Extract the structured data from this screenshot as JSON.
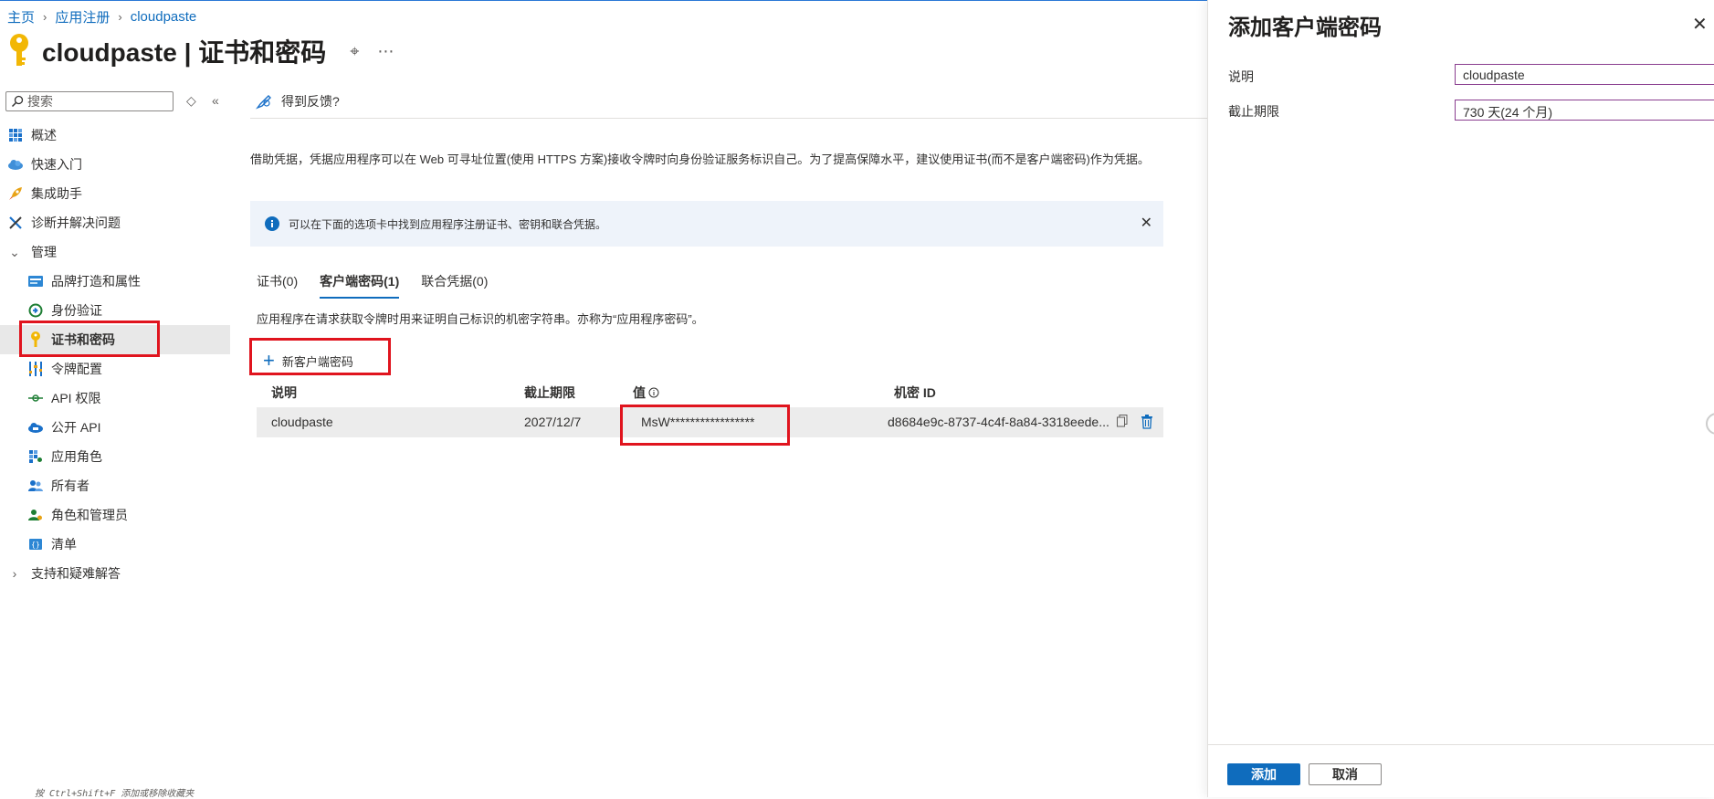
{
  "breadcrumb": [
    "主页",
    "应用注册",
    "cloudpaste"
  ],
  "page_title": "cloudpaste | 证书和密码",
  "sidebar": {
    "search_placeholder": "搜索",
    "items": [
      {
        "label": "概述",
        "icon": "overview-grid-icon",
        "level": 1
      },
      {
        "label": "快速入门",
        "icon": "cloud-quickstart-icon",
        "level": 1
      },
      {
        "label": "集成助手",
        "icon": "rocket-icon",
        "level": 1
      },
      {
        "label": "诊断并解决问题",
        "icon": "wrench-icon",
        "level": 1
      },
      {
        "label": "管理",
        "icon": "chevron-down-icon",
        "level": 1
      },
      {
        "label": "品牌打造和属性",
        "icon": "branding-icon",
        "level": 2
      },
      {
        "label": "身份验证",
        "icon": "authentication-icon",
        "level": 2
      },
      {
        "label": "证书和密码",
        "icon": "key-icon",
        "level": 2,
        "selected": true
      },
      {
        "label": "令牌配置",
        "icon": "token-bars-icon",
        "level": 2
      },
      {
        "label": "API 权限",
        "icon": "api-permissions-icon",
        "level": 2
      },
      {
        "label": "公开 API",
        "icon": "cloud-api-icon",
        "level": 2
      },
      {
        "label": "应用角色",
        "icon": "app-roles-icon",
        "level": 2
      },
      {
        "label": "所有者",
        "icon": "owners-icon",
        "level": 2
      },
      {
        "label": "角色和管理员",
        "icon": "roles-admins-icon",
        "level": 2
      },
      {
        "label": "清单",
        "icon": "manifest-icon",
        "level": 2
      },
      {
        "label": "支持和疑难解答",
        "icon": "chevron-right-icon",
        "level": 1
      }
    ]
  },
  "main": {
    "feedback": "得到反馈?",
    "description": "借助凭据，凭据应用程序可以在 Web 可寻址位置(使用 HTTPS 方案)接收令牌时向身份验证服务标识自己。为了提高保障水平，建议使用证书(而不是客户端密码)作为凭据。",
    "info_banner": "可以在下面的选项卡中找到应用程序注册证书、密钥和联合凭据。",
    "tabs": [
      "证书(0)",
      "客户端密码(1)",
      "联合凭据(0)"
    ],
    "tab_description": "应用程序在请求获取令牌时用来证明自己标识的机密字符串。亦称为“应用程序密码”。",
    "new_secret_button": "新客户端密码",
    "table": {
      "headers": [
        "说明",
        "截止期限",
        "值",
        "机密 ID"
      ],
      "rows": [
        {
          "description": "cloudpaste",
          "expires": "2027/12/7",
          "value": "MsW*****************",
          "secret_id": "d8684e9c-8737-4c4f-8a84-3318eede..."
        }
      ]
    }
  },
  "panel": {
    "title": "添加客户端密码",
    "description_label": "说明",
    "description_value": "cloudpaste",
    "expires_label": "截止期限",
    "expires_value": "730 天(24 个月)",
    "add_button": "添加",
    "cancel_button": "取消"
  },
  "hint": "按 Ctrl+Shift+F 添加或移除收藏夹",
  "colors": {
    "accent": "#0f6cbd",
    "highlight": "#e0141e",
    "key_yellow": "#f2b705"
  }
}
